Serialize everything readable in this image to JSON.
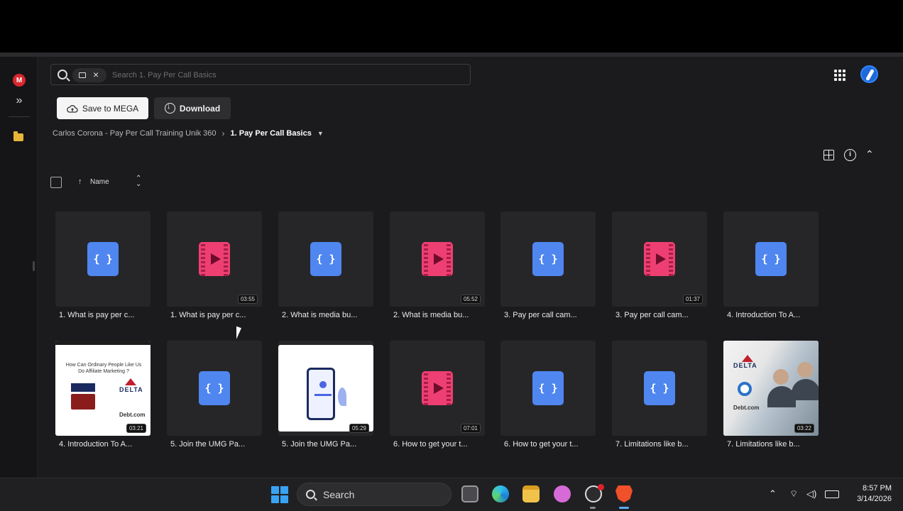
{
  "app": {
    "logo_letter": "M"
  },
  "search": {
    "placeholder": "Search 1. Pay Per Call Basics"
  },
  "toolbar": {
    "save_label": "Save to MEGA",
    "download_label": "Download"
  },
  "breadcrumb": {
    "parent": "Carlos Corona - Pay Per Call Training Unik 360",
    "current": "1. Pay Per Call Basics"
  },
  "sort": {
    "label": "Name"
  },
  "files": [
    {
      "name": "1. What is pay per c...",
      "type": "code",
      "duration": ""
    },
    {
      "name": "1. What is pay per c...",
      "type": "video",
      "duration": "03:55"
    },
    {
      "name": "2. What is media bu...",
      "type": "code",
      "duration": ""
    },
    {
      "name": "2. What is media bu...",
      "type": "video",
      "duration": "05:52"
    },
    {
      "name": "3. Pay per call cam...",
      "type": "code",
      "duration": ""
    },
    {
      "name": "3. Pay per call cam...",
      "type": "video",
      "duration": "01:37"
    },
    {
      "name": "4. Introduction To A...",
      "type": "code",
      "duration": ""
    },
    {
      "name": "4. Introduction To A...",
      "type": "thumb-affiliate",
      "duration": "03:21"
    },
    {
      "name": "5. Join the UMG Pa...",
      "type": "code",
      "duration": ""
    },
    {
      "name": "5. Join the UMG Pa...",
      "type": "thumb-phone",
      "duration": "05:29"
    },
    {
      "name": "6. How to get your t...",
      "type": "video",
      "duration": "07:01"
    },
    {
      "name": "6. How to get your t...",
      "type": "code",
      "duration": ""
    },
    {
      "name": "7. Limitations like b...",
      "type": "code",
      "duration": ""
    },
    {
      "name": "7. Limitations like b...",
      "type": "thumb-callcenter",
      "duration": "03:22"
    }
  ],
  "thumbnails": {
    "affiliate": {
      "title": "How Can Ordinary People Like Us Do Affiliate Marketing ?",
      "brand1": "DELTA",
      "brand2": "Debt.com"
    },
    "callcenter": {
      "brand1": "DELTA",
      "brand2": "Debt.com"
    }
  },
  "taskbar": {
    "search_label": "Search",
    "time": "8:57 PM",
    "date": "3/14/2026"
  },
  "colors": {
    "code_icon": "#4f86f0",
    "video_icon": "#ee3f72",
    "accent": "#d9272e"
  }
}
